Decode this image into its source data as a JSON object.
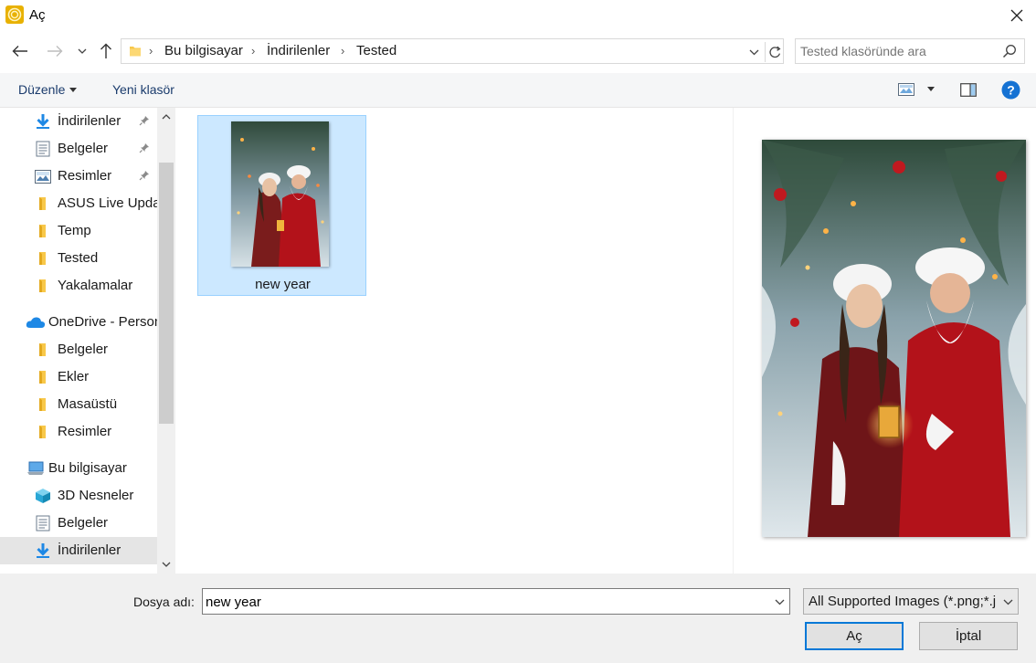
{
  "window": {
    "title": "Aç",
    "icon": "app-logo-icon",
    "close_icon": "close-icon"
  },
  "nav": {
    "back_icon": "arrow-left-icon",
    "forward_icon": "arrow-right-icon",
    "recent_icon": "chevron-down-icon",
    "up_icon": "arrow-up-icon"
  },
  "address": {
    "breadcrumbs": [
      "Bu bilgisayar",
      "İndirilenler",
      "Tested"
    ],
    "refresh_icon": "refresh-icon"
  },
  "search": {
    "placeholder": "Tested klasöründe ara",
    "icon": "search-icon"
  },
  "toolbar": {
    "organize_label": "Düzenle",
    "new_folder_label": "Yeni klasör",
    "view_icon": "view-options-icon",
    "preview_pane_icon": "preview-pane-icon",
    "help_icon": "help-icon"
  },
  "sidebar": {
    "items": [
      {
        "label": "İndirilenler",
        "icon": "download-arrow-icon",
        "pinned": true
      },
      {
        "label": "Belgeler",
        "icon": "document-icon",
        "pinned": true
      },
      {
        "label": "Resimler",
        "icon": "pictures-icon",
        "pinned": true
      },
      {
        "label": "ASUS Live Updat",
        "icon": "folder-icon"
      },
      {
        "label": "Temp",
        "icon": "folder-icon"
      },
      {
        "label": "Tested",
        "icon": "folder-icon"
      },
      {
        "label": "Yakalamalar",
        "icon": "folder-icon"
      },
      {
        "label": "OneDrive - Person",
        "icon": "onedrive-cloud-icon"
      },
      {
        "label": "Belgeler",
        "icon": "folder-icon"
      },
      {
        "label": "Ekler",
        "icon": "folder-icon"
      },
      {
        "label": "Masaüstü",
        "icon": "folder-icon"
      },
      {
        "label": "Resimler",
        "icon": "folder-icon"
      },
      {
        "label": "Bu bilgisayar",
        "icon": "computer-icon"
      },
      {
        "label": "3D Nesneler",
        "icon": "cube-3d-icon"
      },
      {
        "label": "Belgeler",
        "icon": "document-icon"
      },
      {
        "label": "İndirilenler",
        "icon": "download-arrow-icon",
        "selected": true
      }
    ]
  },
  "files": [
    {
      "name": "new year",
      "selected": true
    }
  ],
  "bottom": {
    "filename_label": "Dosya adı:",
    "filename_value": "new year",
    "filter_value": "All Supported Images (*.png;*.jpg",
    "open_label": "Aç",
    "cancel_label": "İptal"
  },
  "colors": {
    "accent": "#0078d7",
    "selection_bg": "#cce8ff",
    "selection_border": "#99d1ff",
    "folder_yellow": "#f8c84a",
    "link_blue": "#1a3b6c"
  }
}
